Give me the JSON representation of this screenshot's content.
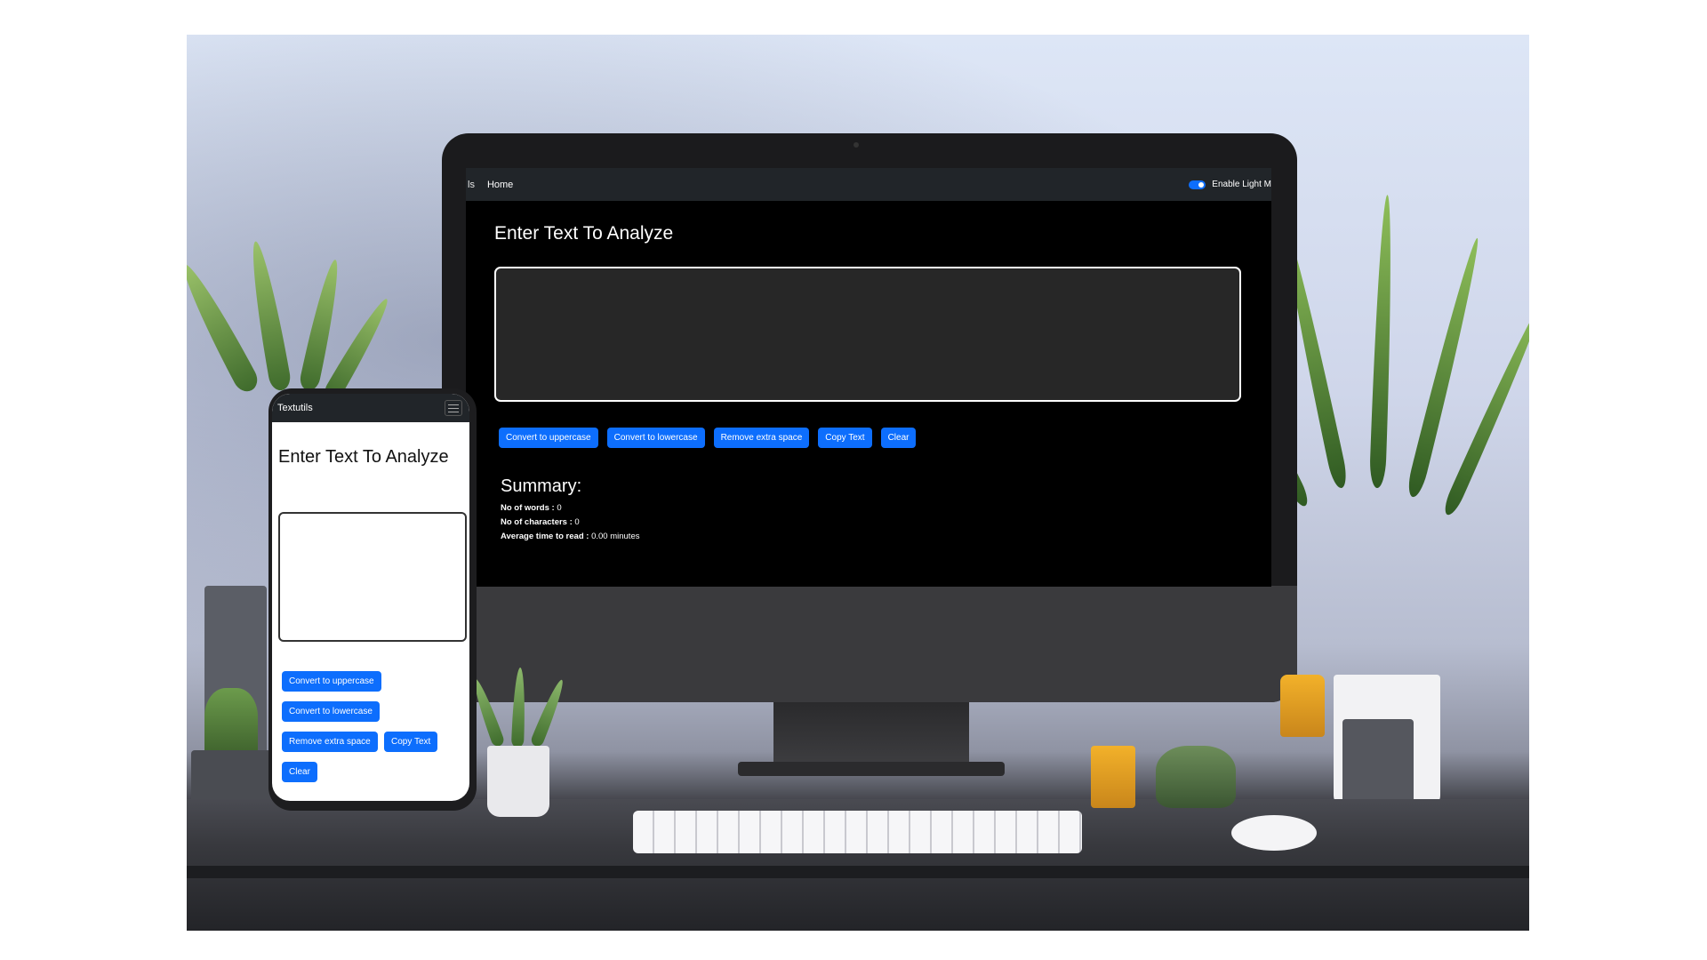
{
  "desktop": {
    "navbar": {
      "brand": "ls",
      "home_link": "Home",
      "toggle_label": "Enable Light M"
    },
    "heading": "Enter Text To Analyze",
    "textarea_value": "",
    "buttons": {
      "uppercase": "Convert to uppercase",
      "lowercase": "Convert to lowercase",
      "remove_space": "Remove extra space",
      "copy": "Copy Text",
      "clear": "Clear"
    },
    "summary": {
      "title": "Summary:",
      "words_label": "No of words :",
      "words_value": "0",
      "chars_label": "No of characters :",
      "chars_value": "0",
      "time_label": "Average time to read :",
      "time_value": "0.00 minutes"
    }
  },
  "mobile": {
    "navbar": {
      "brand": "Textutils",
      "menu_icon": "hamburger-icon"
    },
    "heading": "Enter Text To Analyze",
    "textarea_value": "",
    "buttons": {
      "uppercase": "Convert to uppercase",
      "lowercase": "Convert to lowercase",
      "remove_space": "Remove extra space",
      "copy": "Copy Text",
      "clear": "Clear"
    }
  },
  "colors": {
    "primary": "#0d6efd",
    "navbar": "#212529",
    "dark_bg": "#000000",
    "textarea_dark": "#272727"
  }
}
